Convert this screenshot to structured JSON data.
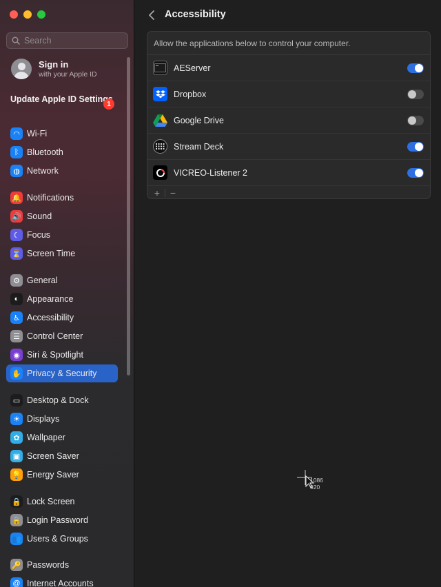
{
  "window": {
    "controls": [
      "close",
      "minimize",
      "maximize"
    ]
  },
  "sidebar": {
    "search_placeholder": "Search",
    "account": {
      "title": "Sign in",
      "subtitle": "with your Apple ID"
    },
    "update": {
      "label": "Update Apple ID Settings",
      "badge": "1"
    },
    "items": [
      {
        "label": "Wi-Fi",
        "icon": "wifi-icon",
        "color": "#1a82f7",
        "glyph": "◠"
      },
      {
        "label": "Bluetooth",
        "icon": "bluetooth-icon",
        "color": "#1a82f7",
        "glyph": "ᛒ"
      },
      {
        "label": "Network",
        "icon": "globe-icon",
        "color": "#1a82f7",
        "glyph": "◍"
      },
      {
        "label": "Notifications",
        "icon": "bell-icon",
        "color": "#ef3b3b",
        "glyph": "🔔"
      },
      {
        "label": "Sound",
        "icon": "speaker-icon",
        "color": "#ef3b3b",
        "glyph": "🔊"
      },
      {
        "label": "Focus",
        "icon": "moon-icon",
        "color": "#5e5ce6",
        "glyph": "☾"
      },
      {
        "label": "Screen Time",
        "icon": "hourglass-icon",
        "color": "#5e5ce6",
        "glyph": "⌛"
      },
      {
        "label": "General",
        "icon": "gear-icon",
        "color": "#8e8e93",
        "glyph": "⚙"
      },
      {
        "label": "Appearance",
        "icon": "appearance-icon",
        "color": "#1c1c1e",
        "glyph": "◐"
      },
      {
        "label": "Accessibility",
        "icon": "accessibility-icon",
        "color": "#1a82f7",
        "glyph": "♿"
      },
      {
        "label": "Control Center",
        "icon": "switches-icon",
        "color": "#8e8e93",
        "glyph": "☰"
      },
      {
        "label": "Siri & Spotlight",
        "icon": "siri-icon",
        "color": "#7a3fd1",
        "glyph": "◉"
      },
      {
        "label": "Privacy & Security",
        "icon": "hand-icon",
        "color": "#1a82f7",
        "glyph": "✋",
        "selected": true
      },
      {
        "label": "Desktop & Dock",
        "icon": "dock-icon",
        "color": "#1c1c1e",
        "glyph": "▭"
      },
      {
        "label": "Displays",
        "icon": "sun-icon",
        "color": "#1a82f7",
        "glyph": "☀"
      },
      {
        "label": "Wallpaper",
        "icon": "flower-icon",
        "color": "#32ade6",
        "glyph": "✿"
      },
      {
        "label": "Screen Saver",
        "icon": "screensaver-icon",
        "color": "#32ade6",
        "glyph": "▣"
      },
      {
        "label": "Energy Saver",
        "icon": "lightbulb-icon",
        "color": "#ff9f0a",
        "glyph": "💡"
      },
      {
        "label": "Lock Screen",
        "icon": "lock-screen-icon",
        "color": "#1c1c1e",
        "glyph": "🔒"
      },
      {
        "label": "Login Password",
        "icon": "lock-icon",
        "color": "#8e8e93",
        "glyph": "🔒"
      },
      {
        "label": "Users & Groups",
        "icon": "users-icon",
        "color": "#1a82f7",
        "glyph": "👥"
      },
      {
        "label": "Passwords",
        "icon": "key-icon",
        "color": "#8e8e93",
        "glyph": "🔑"
      },
      {
        "label": "Internet Accounts",
        "icon": "at-icon",
        "color": "#1a82f7",
        "glyph": "@"
      }
    ]
  },
  "main": {
    "title": "Accessibility",
    "panel_header": "Allow the applications below to control your computer.",
    "apps": [
      {
        "name": "AEServer",
        "icon": "terminal-icon",
        "enabled": true
      },
      {
        "name": "Dropbox",
        "icon": "dropbox-icon",
        "enabled": false
      },
      {
        "name": "Google Drive",
        "icon": "google-drive-icon",
        "enabled": false
      },
      {
        "name": "Stream Deck",
        "icon": "stream-deck-icon",
        "enabled": true
      },
      {
        "name": "VICREO-Listener 2",
        "icon": "vicreo-icon",
        "enabled": true
      }
    ],
    "add_label": "+",
    "remove_label": "−",
    "cursor_readout": {
      "x": "1086",
      "y": "920"
    }
  }
}
